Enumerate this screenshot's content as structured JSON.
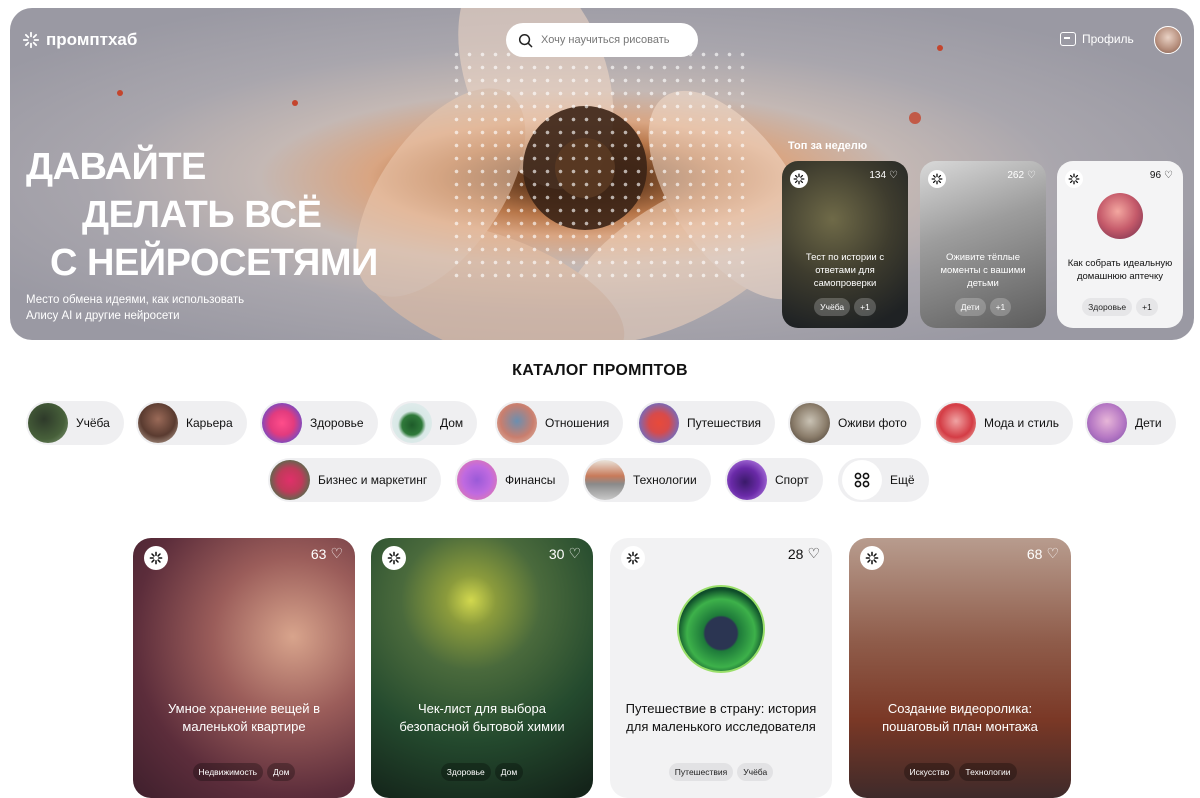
{
  "header": {
    "logo_text": "промптхаб",
    "search_placeholder": "Хочу научиться рисовать",
    "profile_label": "Профиль"
  },
  "hero": {
    "headline": [
      "ДАВАЙТЕ",
      "ДЕЛАТЬ ВСЁ",
      "С НЕЙРОСЕТЯМИ"
    ],
    "subtitle": "Место обмена идеями, как использовать Алису AI и другие нейросети",
    "top_week_label": "Топ за неделю",
    "top_cards": [
      {
        "title": "Тест по истории с ответами для самопроверки",
        "likes": "134",
        "tags": [
          "Учёба",
          "+1"
        ]
      },
      {
        "title": "Оживите тёплые моменты с вашими детьми",
        "likes": "262",
        "tags": [
          "Дети",
          "+1"
        ]
      },
      {
        "title": "Как собрать идеальную домашнюю аптечку",
        "likes": "96",
        "tags": [
          "Здоровье",
          "+1"
        ]
      }
    ]
  },
  "catalog": {
    "title": "КАТАЛОГ ПРОМПТОВ",
    "row1": [
      "Учёба",
      "Карьера",
      "Здоровье",
      "Дом",
      "Отношения",
      "Путешествия",
      "Оживи фото",
      "Мода и стиль",
      "Дети"
    ],
    "row2": [
      "Бизнес и маркетинг",
      "Финансы",
      "Технологии",
      "Спорт",
      "Ещё"
    ]
  },
  "cards": [
    {
      "title": "Умное хранение вещей в маленькой квартире",
      "likes": "63",
      "tags": [
        "Недвижимость",
        "Дом"
      ]
    },
    {
      "title": "Чек-лист для выбора безопасной бытовой химии",
      "likes": "30",
      "tags": [
        "Здоровье",
        "Дом"
      ]
    },
    {
      "title": "Путешествие в страну: история для маленького исследователя",
      "likes": "28",
      "tags": [
        "Путешествия",
        "Учёба"
      ]
    },
    {
      "title": "Создание видеоролика: пошаговый план монтажа",
      "likes": "68",
      "tags": [
        "Искусство",
        "Технологии"
      ]
    }
  ]
}
